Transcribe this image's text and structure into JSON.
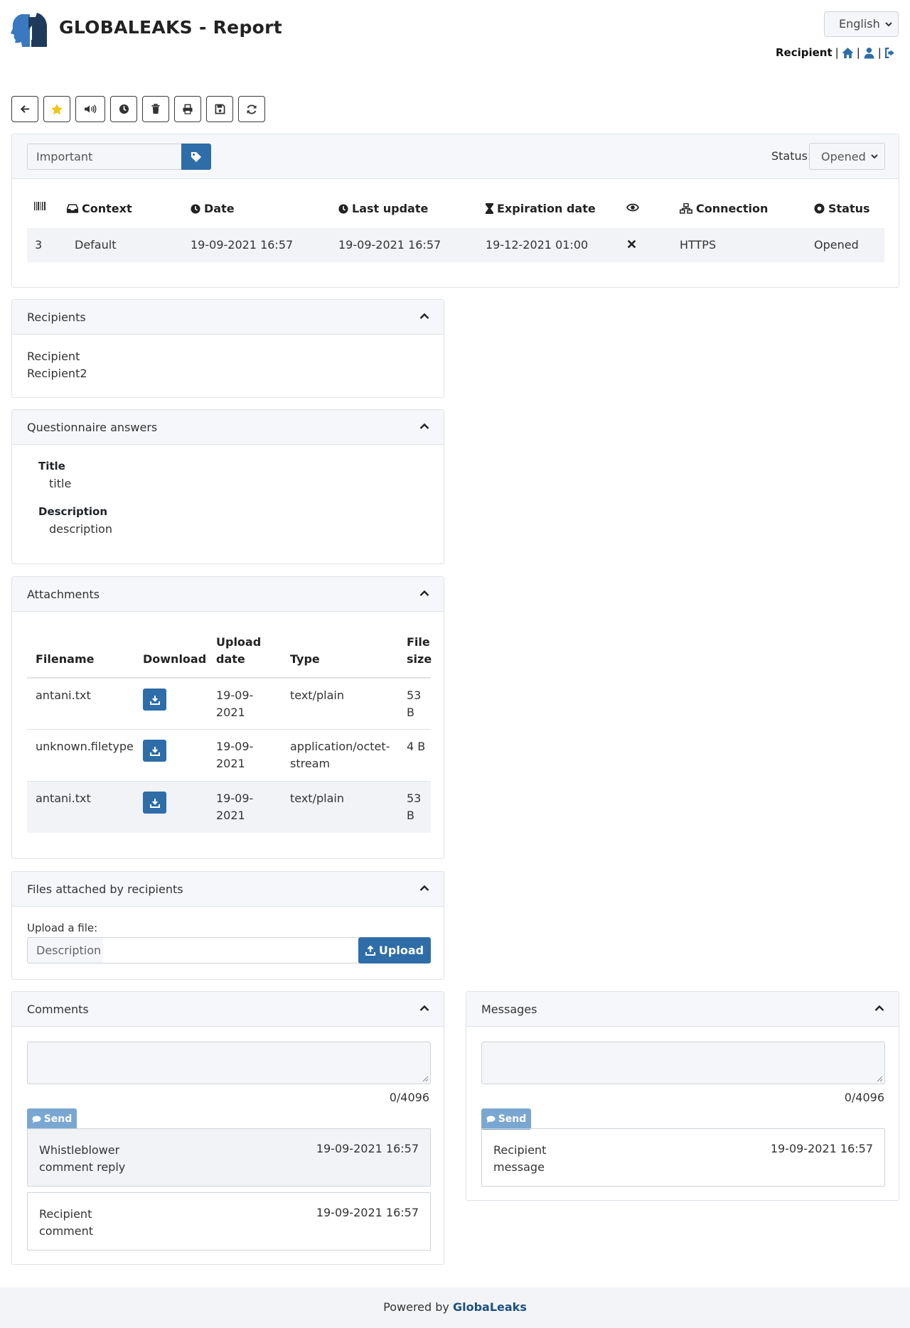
{
  "header": {
    "title": "GLOBALEAKS - Report",
    "language": "English",
    "user_label": "Recipient",
    "separator": "|"
  },
  "toolbar": {
    "buttons": [
      "back-icon",
      "star-icon",
      "megaphone-icon",
      "clock-icon",
      "trash-icon",
      "print-icon",
      "save-icon",
      "refresh-icon"
    ]
  },
  "report": {
    "tag_value": "Important",
    "status_label": "Status:",
    "status_value": "Opened",
    "columns": {
      "context": "Context",
      "date": "Date",
      "last_update": "Last update",
      "expiration": "Expiration date",
      "connection": "Connection",
      "status": "Status"
    },
    "row": {
      "id": "3",
      "context": "Default",
      "date": "19-09-2021 16:57",
      "last_update": "19-09-2021 16:57",
      "expiration": "19-12-2021 01:00",
      "connection": "HTTPS",
      "status": "Opened"
    }
  },
  "recipients": {
    "title": "Recipients",
    "items": [
      "Recipient",
      "Recipient2"
    ]
  },
  "questionnaire": {
    "title": "Questionnaire answers",
    "fields": [
      {
        "label": "Title",
        "value": "title"
      },
      {
        "label": "Description",
        "value": "description"
      }
    ]
  },
  "attachments": {
    "title": "Attachments",
    "columns": {
      "filename": "Filename",
      "download": "Download",
      "upload_date": "Upload date",
      "type": "Type",
      "size": "File size"
    },
    "rows": [
      {
        "filename": "antani.txt",
        "date": "19-09-2021",
        "type": "text/plain",
        "size": "53 B"
      },
      {
        "filename": "unknown.filetype",
        "date": "19-09-2021",
        "type": "application/octet-stream",
        "size": "4 B"
      },
      {
        "filename": "antani.txt",
        "date": "19-09-2021",
        "type": "text/plain",
        "size": "53 B"
      }
    ]
  },
  "recipient_files": {
    "title": "Files attached by recipients",
    "upload_label": "Upload a file:",
    "description_placeholder": "Description",
    "upload_button": "Upload"
  },
  "comments": {
    "title": "Comments",
    "counter": "0/4096",
    "send_label": "Send",
    "items": [
      {
        "author": "Whistleblower comment reply",
        "date": "19-09-2021 16:57"
      },
      {
        "author": "Recipient comment",
        "date": "19-09-2021 16:57"
      }
    ]
  },
  "messages": {
    "title": "Messages",
    "counter": "0/4096",
    "send_label": "Send",
    "items": [
      {
        "author": "Recipient message",
        "date": "19-09-2021 16:57"
      }
    ]
  },
  "footer": {
    "prefix": "Powered by",
    "brand": "GlobaLeaks"
  },
  "colors": {
    "primary": "#2e6da8",
    "send_disabled": "#7aa7d1",
    "star": "#f0c419"
  }
}
